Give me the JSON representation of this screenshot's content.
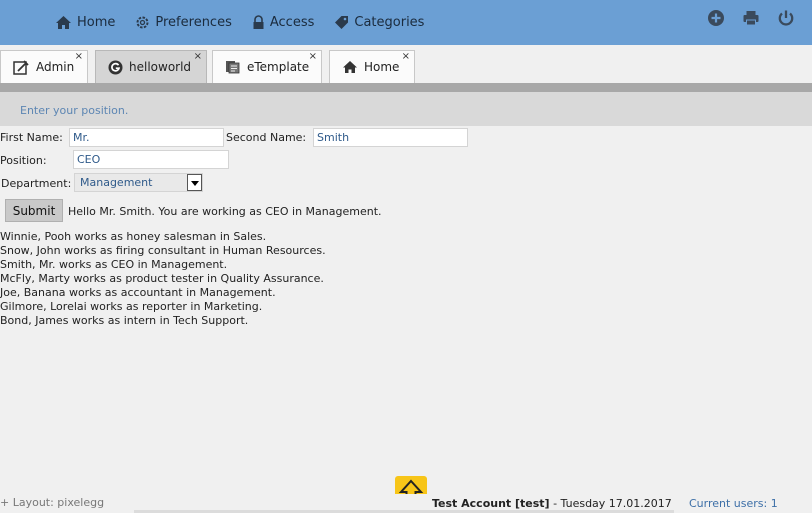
{
  "topnav": {
    "items": [
      {
        "label": "Home",
        "icon": "home-icon"
      },
      {
        "label": "Preferences",
        "icon": "gear-icon"
      },
      {
        "label": "Access",
        "icon": "lock-icon"
      },
      {
        "label": "Categories",
        "icon": "tag-icon"
      }
    ],
    "right_icons": [
      "add-icon",
      "print-icon",
      "power-icon"
    ]
  },
  "tabs": [
    {
      "label": "Admin",
      "icon": "admin-icon"
    },
    {
      "label": "helloworld",
      "icon": "g-icon",
      "active": true
    },
    {
      "label": "eTemplate",
      "icon": "etemplate-icon"
    },
    {
      "label": "Home",
      "icon": "home-icon"
    }
  ],
  "tab_close": "×",
  "hint": "Enter your position.",
  "form": {
    "first_name_label": "First Name:",
    "first_name_value": "Mr.",
    "second_name_label": "Second Name:",
    "second_name_value": "Smith",
    "position_label": "Position:",
    "position_value": "CEO",
    "department_label": "Department:",
    "department_value": "Management",
    "submit_label": "Submit",
    "result": "Hello Mr. Smith. You are working as CEO in Management."
  },
  "employees": [
    "Winnie, Pooh works as honey salesman in Sales.",
    "Snow, John works as firing consultant in Human Resources.",
    "Smith, Mr. works as CEO in Management.",
    "McFly, Marty works as product tester in Quality Assurance.",
    "Joe, Banana works as accountant in Management.",
    "Gilmore, Lorelai works as reporter in Marketing.",
    "Bond, James works as intern in Tech Support."
  ],
  "footer": {
    "layout": "+ Layout: pixelegg",
    "account": "Test Account [test]",
    "date": " - Tuesday 17.01.2017",
    "users": "Current users: 1"
  },
  "colors": {
    "topbar": "#6b9fd4",
    "accent_text": "#3d6fa7",
    "up_button": "#f7c518"
  }
}
